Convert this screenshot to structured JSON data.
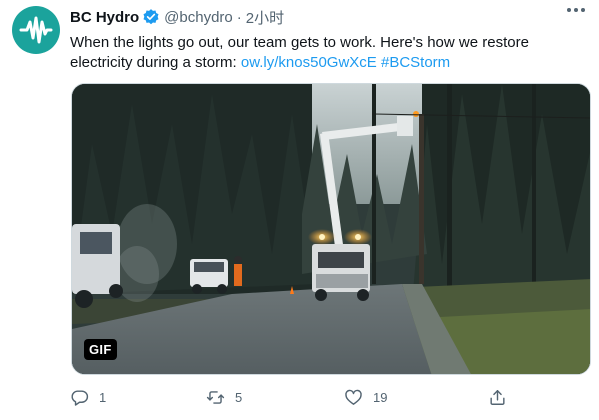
{
  "account": {
    "display_name": "BC Hydro",
    "handle": "@bchydro",
    "separator": "·",
    "timestamp": "2小时",
    "avatar_color": "#1ba39c",
    "verified_color": "#1d9bf0"
  },
  "tweet": {
    "text": "When the lights go out, our team gets to work. Here's how we restore electricity during a storm:",
    "link": "ow.ly/knos50GwXcE",
    "hashtag": "#BCStorm",
    "link_color": "#1d9bf0"
  },
  "media": {
    "badge": "GIF"
  },
  "actions": {
    "reply_count": "1",
    "retweet_count": "5",
    "like_count": "19"
  },
  "icons": [
    "bchydro-logo-icon",
    "verified-badge-icon",
    "more-options-icon",
    "reply-icon",
    "retweet-icon",
    "like-icon",
    "share-icon"
  ]
}
